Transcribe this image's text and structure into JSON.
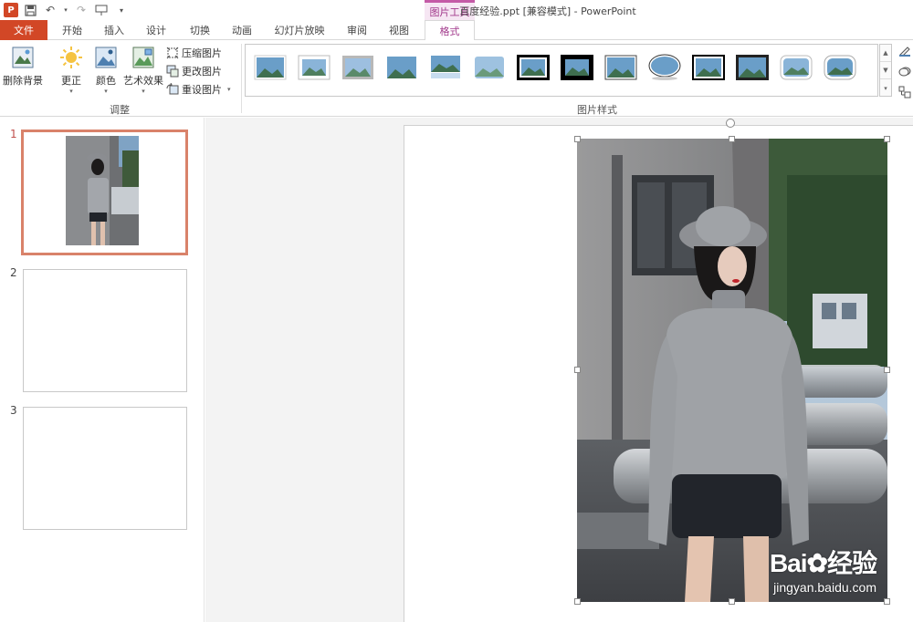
{
  "window": {
    "title": "百度经验.ppt [兼容模式] - PowerPoint",
    "context_tab_header": "图片工具"
  },
  "quick_access": {
    "items": [
      "ppt-logo",
      "save-icon",
      "undo-icon",
      "redo-icon",
      "present-icon",
      "customize-icon"
    ]
  },
  "tabs": [
    "文件",
    "开始",
    "插入",
    "设计",
    "切换",
    "动画",
    "幻灯片放映",
    "审阅",
    "视图",
    "格式"
  ],
  "ribbon": {
    "remove_bg": "删除背景",
    "corrections": "更正",
    "color": "颜色",
    "artistic": "艺术效果",
    "compress": "压缩图片",
    "change": "更改图片",
    "reset": "重设图片",
    "adjust_group": "调整",
    "styles_group": "图片样式"
  },
  "slides": {
    "numbers": [
      "1",
      "2",
      "3"
    ],
    "active_index": 0
  },
  "watermark": {
    "brand": "Bai",
    "brand_cn": "经验",
    "url": "jingyan.baidu.com"
  },
  "colors": {
    "accent": "#d24726",
    "context": "#a23a8c",
    "thumb_border": "#d9826a"
  }
}
